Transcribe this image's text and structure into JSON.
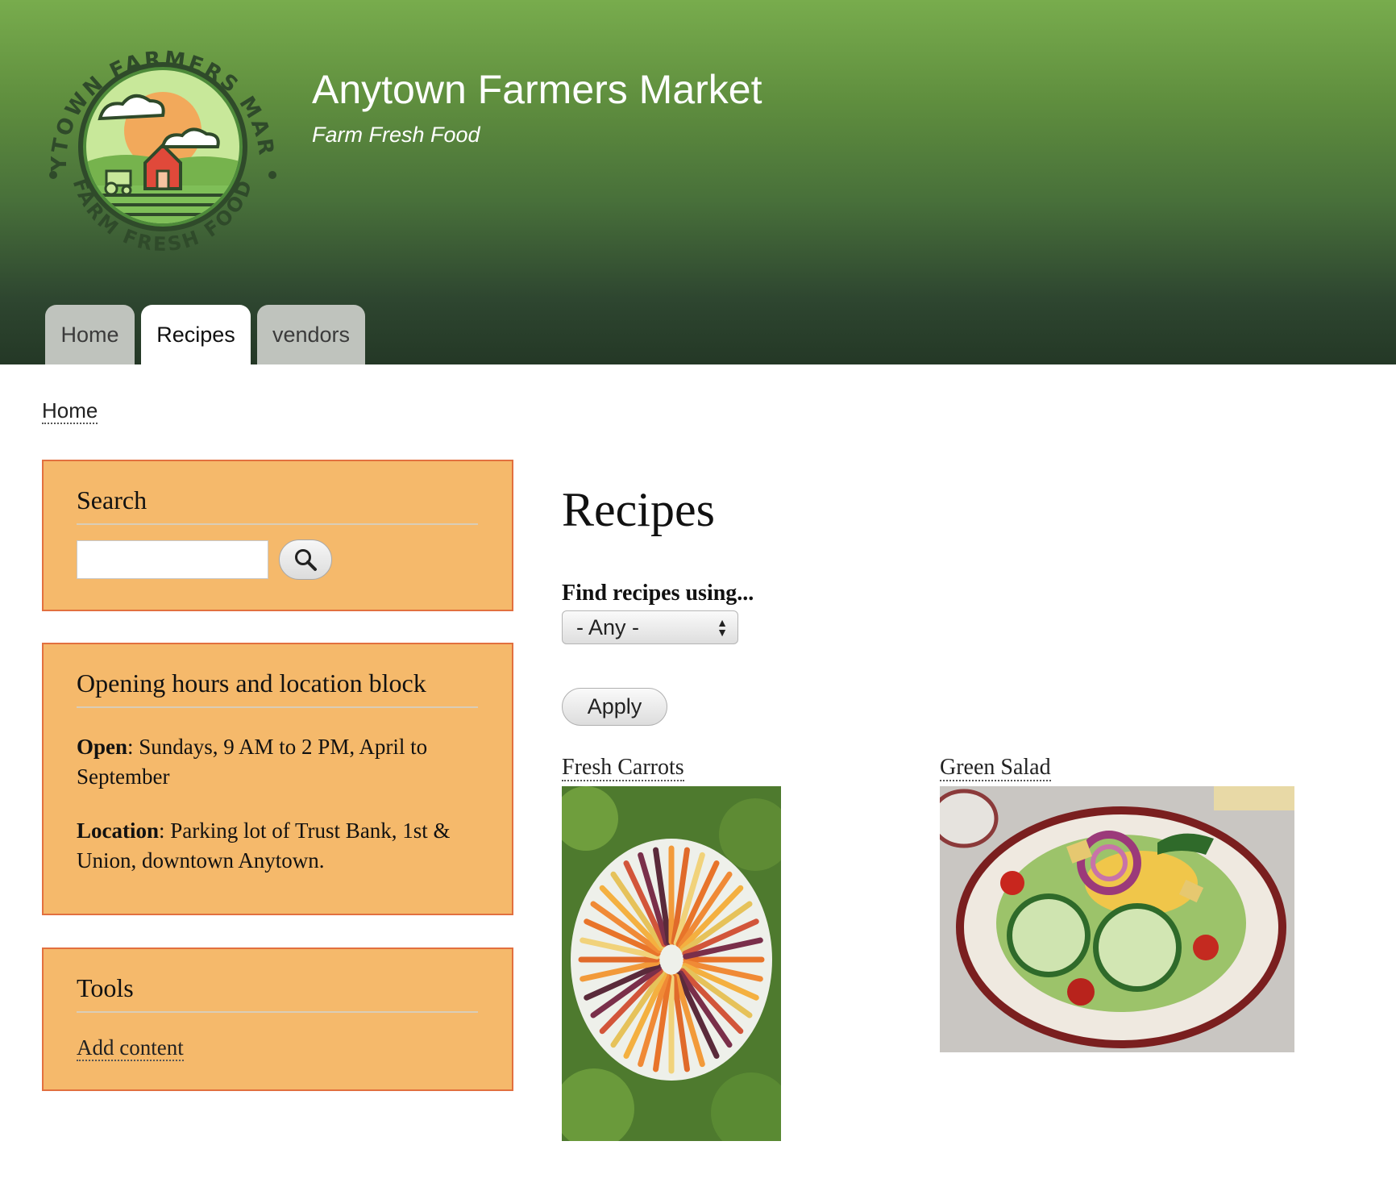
{
  "site": {
    "name": "Anytown Farmers Market",
    "slogan": "Farm Fresh Food",
    "logo_text_top": "ANYTOWN FARMERS MARKET",
    "logo_text_bottom": "FARM FRESH FOOD"
  },
  "nav": {
    "tabs": [
      {
        "label": "Home",
        "active": false
      },
      {
        "label": "Recipes",
        "active": true
      },
      {
        "label": "vendors",
        "active": false
      }
    ]
  },
  "breadcrumb": {
    "home": "Home"
  },
  "sidebar": {
    "search": {
      "title": "Search",
      "value": "",
      "button_icon": "search-icon"
    },
    "hours": {
      "title": "Opening hours and location block",
      "open_label": "Open",
      "open_text": ": Sundays, 9 AM to 2 PM, April to September",
      "location_label": "Location",
      "location_text": ": Parking lot of Trust Bank, 1st & Union, downtown Anytown."
    },
    "tools": {
      "title": "Tools",
      "link": "Add content"
    }
  },
  "main": {
    "title": "Recipes",
    "filter": {
      "label": "Find recipes using...",
      "selected": "- Any -"
    },
    "apply_label": "Apply",
    "recipes": [
      {
        "title": "Fresh Carrots",
        "image": "carrots-photo"
      },
      {
        "title": "Green Salad",
        "image": "salad-photo"
      }
    ]
  },
  "colors": {
    "header_top": "#78ac4d",
    "header_bottom": "#243826",
    "block_bg": "#f5b96b",
    "block_border": "#e2703f",
    "tab_inactive": "#bfc3bd"
  }
}
